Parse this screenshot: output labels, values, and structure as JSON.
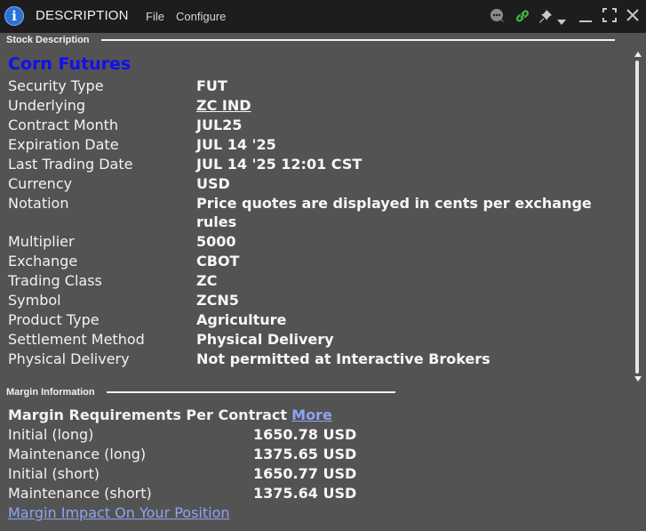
{
  "window": {
    "title": "DESCRIPTION",
    "menu": [
      "File",
      "Configure"
    ],
    "icons": [
      "info-icon",
      "chat-icon",
      "link-icon",
      "pin-icon",
      "dropdown-arrow-icon",
      "minimize-icon",
      "maximize-icon",
      "close-icon"
    ]
  },
  "stock_description": {
    "section_label": "Stock Description",
    "contract_title": "Corn Futures",
    "rows": [
      {
        "label": "Security Type",
        "value": "FUT"
      },
      {
        "label": "Underlying",
        "value": "ZC IND",
        "is_link": true
      },
      {
        "label": "Contract Month",
        "value": "JUL25"
      },
      {
        "label": "Expiration Date",
        "value": "JUL 14 '25"
      },
      {
        "label": "Last Trading Date",
        "value": "JUL 14 '25 12:01 CST"
      },
      {
        "label": "Currency",
        "value": "USD"
      },
      {
        "label": "Notation",
        "value": "Price quotes are displayed in cents per exchange rules"
      },
      {
        "label": "Multiplier",
        "value": "5000"
      },
      {
        "label": "Exchange",
        "value": "CBOT"
      },
      {
        "label": "Trading Class",
        "value": "ZC"
      },
      {
        "label": "Symbol",
        "value": "ZCN5"
      },
      {
        "label": "Product Type",
        "value": "Agriculture"
      },
      {
        "label": "Settlement Method",
        "value": "Physical Delivery"
      },
      {
        "label": "Physical Delivery",
        "value": "Not permitted at Interactive Brokers"
      }
    ]
  },
  "margin_information": {
    "section_label": "Margin Information",
    "heading": "Margin Requirements Per Contract",
    "more_link": "More",
    "rows": [
      {
        "label": "Initial (long)",
        "value": "1650.78 USD"
      },
      {
        "label": "Maintenance (long)",
        "value": "1375.65 USD"
      },
      {
        "label": "Initial (short)",
        "value": "1650.77 USD"
      },
      {
        "label": "Maintenance (short)",
        "value": "1375.64 USD"
      }
    ],
    "impact_link": "Margin Impact On Your Position"
  },
  "colors": {
    "background": "#535353",
    "titlebar": "#1d1d1d",
    "contract_title": "#1010ee",
    "link": "#8fa3f0",
    "icon_green": "#3fbf3f"
  }
}
